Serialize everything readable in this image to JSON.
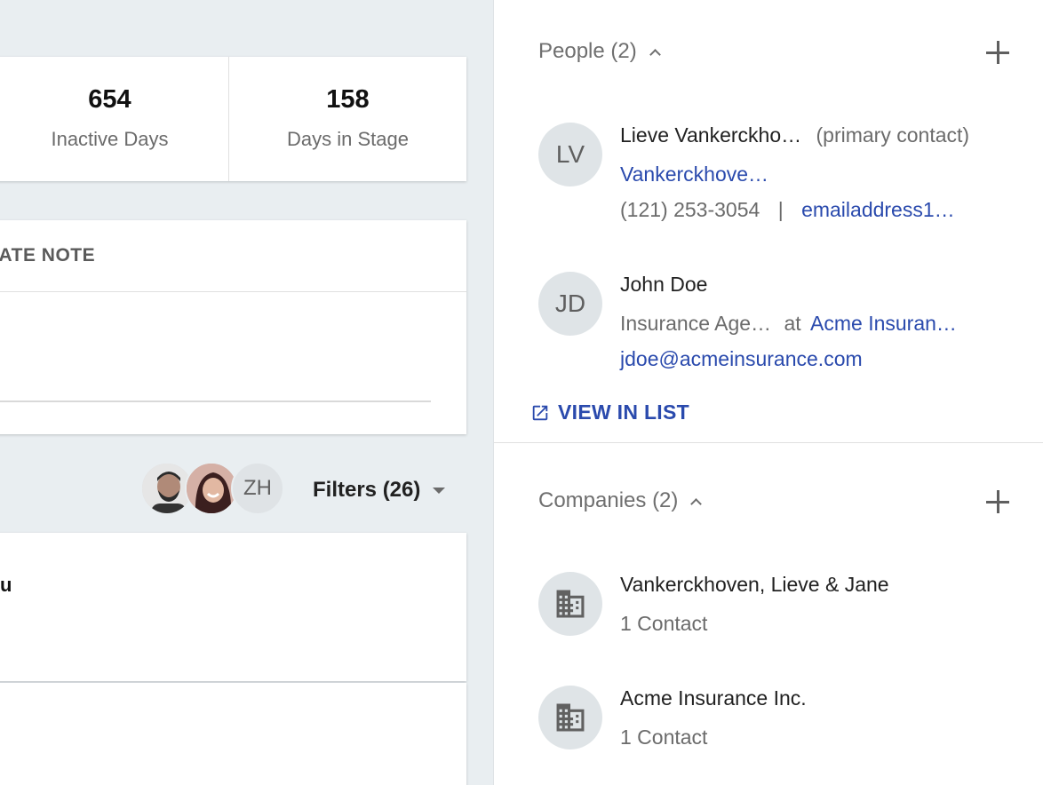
{
  "stats": [
    {
      "value": "654",
      "label": "Inactive Days"
    },
    {
      "value": "158",
      "label": "Days in Stage"
    }
  ],
  "note": {
    "title": "EATE NOTE"
  },
  "filters_bar": {
    "avatar_initials": "ZH",
    "filters_label": "Filters (26)"
  },
  "feed": {
    "text": "u"
  },
  "people": {
    "title": "People (2)",
    "contacts": [
      {
        "initials": "LV",
        "name": "Lieve Vankerckho…",
        "role_note": "(primary contact)",
        "company": "Vankerckhove…",
        "phone": "(121) 253-3054",
        "separator": "|",
        "email": "emailaddress1…"
      },
      {
        "initials": "JD",
        "name": "John Doe",
        "job_title": "Insurance Age…",
        "at": "at",
        "company": "Acme Insuran…",
        "email": "jdoe@acmeinsurance.com"
      }
    ],
    "view_in_list": "VIEW IN LIST"
  },
  "companies": {
    "title": "Companies (2)",
    "items": [
      {
        "name": "Vankerckhoven, Lieve & Jane",
        "contacts": "1 Contact"
      },
      {
        "name": "Acme Insurance Inc.",
        "contacts": "1 Contact"
      }
    ]
  },
  "colors": {
    "link": "#2a4aad",
    "background": "#e9eef1"
  },
  "icons": [
    "add-icon",
    "chevron-up-icon",
    "building-icon",
    "open-in-new-icon",
    "caret-down-icon"
  ]
}
